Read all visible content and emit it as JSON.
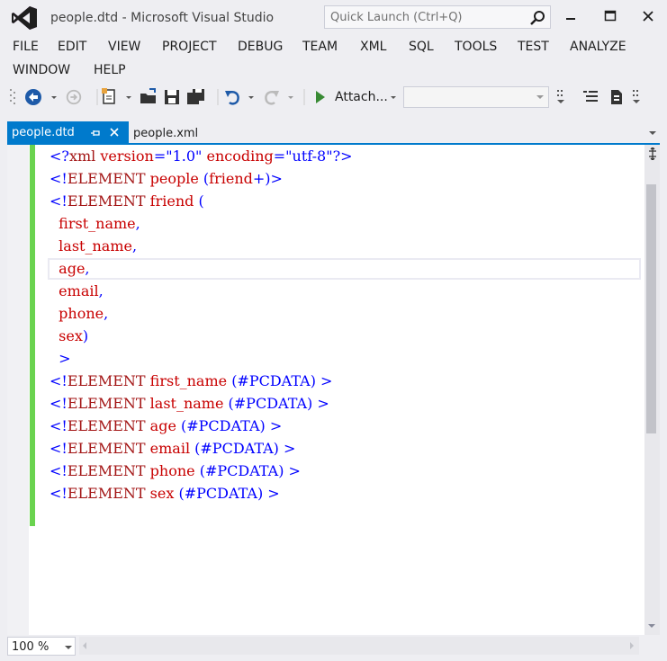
{
  "window": {
    "title": "people.dtd - Microsoft Visual Studio",
    "quick_launch_placeholder": "Quick Launch (Ctrl+Q)"
  },
  "menu": {
    "items": [
      "FILE",
      "EDIT",
      "VIEW",
      "PROJECT",
      "DEBUG",
      "TEAM",
      "XML",
      "SQL",
      "TOOLS",
      "TEST",
      "ANALYZE",
      "WINDOW",
      "HELP"
    ]
  },
  "toolbar": {
    "attach_label": "Attach...",
    "target_value": ""
  },
  "tabs": [
    {
      "label": "people.dtd",
      "active": true
    },
    {
      "label": "people.xml",
      "active": false
    }
  ],
  "editor": {
    "zoom": "100 %",
    "lines": [
      [
        {
          "t": "<?",
          "c": "blue"
        },
        {
          "t": "xml ",
          "c": "brown"
        },
        {
          "t": "version",
          "c": "red"
        },
        {
          "t": "=\"",
          "c": "blue"
        },
        {
          "t": "1.0",
          "c": "blue"
        },
        {
          "t": "\" ",
          "c": "blue"
        },
        {
          "t": "encoding",
          "c": "red"
        },
        {
          "t": "=\"",
          "c": "blue"
        },
        {
          "t": "utf-8",
          "c": "blue"
        },
        {
          "t": "\"?>",
          "c": "blue"
        }
      ],
      [
        {
          "t": "<!",
          "c": "blue"
        },
        {
          "t": "ELEMENT ",
          "c": "brown"
        },
        {
          "t": "people ",
          "c": "red"
        },
        {
          "t": "(",
          "c": "blue"
        },
        {
          "t": "friend",
          "c": "red"
        },
        {
          "t": "+)>",
          "c": "blue"
        }
      ],
      [
        {
          "t": "<!",
          "c": "blue"
        },
        {
          "t": "ELEMENT ",
          "c": "brown"
        },
        {
          "t": "friend ",
          "c": "red"
        },
        {
          "t": "(",
          "c": "blue"
        }
      ],
      [
        {
          "t": "  first_name",
          "c": "red"
        },
        {
          "t": ",",
          "c": "blue"
        }
      ],
      [
        {
          "t": "  last_name",
          "c": "red"
        },
        {
          "t": ",",
          "c": "blue"
        }
      ],
      [
        {
          "t": "  age",
          "c": "red"
        },
        {
          "t": ",",
          "c": "blue"
        }
      ],
      [
        {
          "t": "  email",
          "c": "red"
        },
        {
          "t": ",",
          "c": "blue"
        }
      ],
      [
        {
          "t": "  phone",
          "c": "red"
        },
        {
          "t": ",",
          "c": "blue"
        }
      ],
      [
        {
          "t": "  sex",
          "c": "red"
        },
        {
          "t": ")",
          "c": "blue"
        }
      ],
      [
        {
          "t": "  >",
          "c": "blue"
        }
      ],
      [
        {
          "t": "<!",
          "c": "blue"
        },
        {
          "t": "ELEMENT ",
          "c": "brown"
        },
        {
          "t": "first_name ",
          "c": "red"
        },
        {
          "t": "(#PCDATA) >",
          "c": "blue"
        }
      ],
      [
        {
          "t": "<!",
          "c": "blue"
        },
        {
          "t": "ELEMENT ",
          "c": "brown"
        },
        {
          "t": "last_name ",
          "c": "red"
        },
        {
          "t": "(#PCDATA) >",
          "c": "blue"
        }
      ],
      [
        {
          "t": "<!",
          "c": "blue"
        },
        {
          "t": "ELEMENT ",
          "c": "brown"
        },
        {
          "t": "age ",
          "c": "red"
        },
        {
          "t": "(#PCDATA) >",
          "c": "blue"
        }
      ],
      [
        {
          "t": "<!",
          "c": "blue"
        },
        {
          "t": "ELEMENT ",
          "c": "brown"
        },
        {
          "t": "email ",
          "c": "red"
        },
        {
          "t": "(#PCDATA) >",
          "c": "blue"
        }
      ],
      [
        {
          "t": "<!",
          "c": "blue"
        },
        {
          "t": "ELEMENT ",
          "c": "brown"
        },
        {
          "t": "phone ",
          "c": "red"
        },
        {
          "t": "(#PCDATA) >",
          "c": "blue"
        }
      ],
      [
        {
          "t": "<!",
          "c": "blue"
        },
        {
          "t": "ELEMENT ",
          "c": "brown"
        },
        {
          "t": "sex ",
          "c": "red"
        },
        {
          "t": "(#PCDATA) >",
          "c": "blue"
        }
      ]
    ],
    "current_line_index": 5
  },
  "colors": {
    "accent": "#007acc",
    "change_bar": "#6ad34f",
    "keyword_blue": "#0000ff",
    "name_red": "#c80000"
  }
}
